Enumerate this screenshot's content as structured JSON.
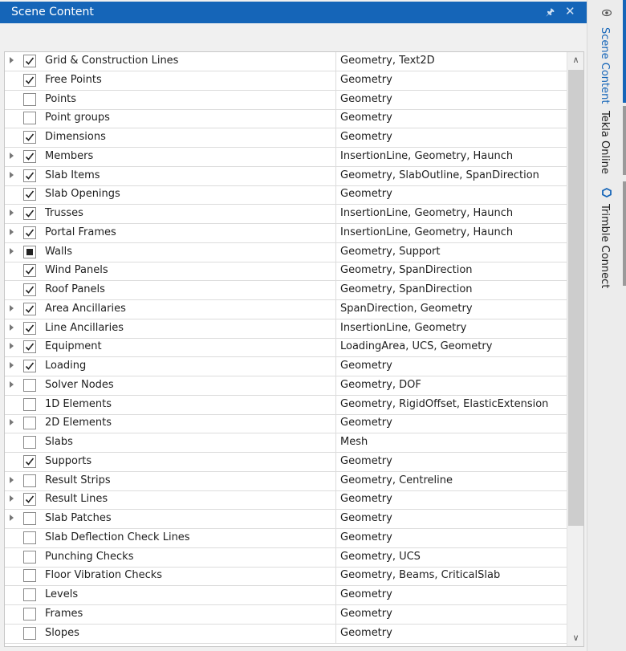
{
  "panel": {
    "title": "Scene Content",
    "pin_icon": "pin-icon",
    "close_icon": "close-icon"
  },
  "side_tabs": [
    {
      "label": "Scene Content",
      "icon": "eye-icon",
      "active": true
    },
    {
      "label": "Tekla Online",
      "active": false
    },
    {
      "label": "Trimble Connect",
      "icon": "trimble-connect-icon",
      "active": false
    }
  ],
  "rows": [
    {
      "name": "Grid & Construction Lines",
      "value": "Geometry, Text2D",
      "state": "checked",
      "expandable": true
    },
    {
      "name": "Free Points",
      "value": "Geometry",
      "state": "checked",
      "expandable": false
    },
    {
      "name": "Points",
      "value": "Geometry",
      "state": "unchecked",
      "expandable": false
    },
    {
      "name": "Point groups",
      "value": "Geometry",
      "state": "unchecked",
      "expandable": false
    },
    {
      "name": "Dimensions",
      "value": "Geometry",
      "state": "checked",
      "expandable": false
    },
    {
      "name": "Members",
      "value": "InsertionLine, Geometry, Haunch",
      "state": "checked",
      "expandable": true
    },
    {
      "name": "Slab Items",
      "value": "Geometry, SlabOutline, SpanDirection",
      "state": "checked",
      "expandable": true
    },
    {
      "name": "Slab Openings",
      "value": "Geometry",
      "state": "checked",
      "expandable": false
    },
    {
      "name": "Trusses",
      "value": "InsertionLine, Geometry, Haunch",
      "state": "checked",
      "expandable": true
    },
    {
      "name": "Portal Frames",
      "value": "InsertionLine, Geometry, Haunch",
      "state": "checked",
      "expandable": true
    },
    {
      "name": "Walls",
      "value": "Geometry, Support",
      "state": "indeterminate",
      "expandable": true
    },
    {
      "name": "Wind Panels",
      "value": "Geometry, SpanDirection",
      "state": "checked",
      "expandable": false
    },
    {
      "name": "Roof Panels",
      "value": "Geometry, SpanDirection",
      "state": "checked",
      "expandable": false
    },
    {
      "name": "Area Ancillaries",
      "value": "SpanDirection, Geometry",
      "state": "checked",
      "expandable": true
    },
    {
      "name": "Line Ancillaries",
      "value": "InsertionLine, Geometry",
      "state": "checked",
      "expandable": true
    },
    {
      "name": "Equipment",
      "value": "LoadingArea, UCS, Geometry",
      "state": "checked",
      "expandable": true
    },
    {
      "name": "Loading",
      "value": "Geometry",
      "state": "checked",
      "expandable": true
    },
    {
      "name": "Solver Nodes",
      "value": "Geometry, DOF",
      "state": "unchecked",
      "expandable": true
    },
    {
      "name": "1D Elements",
      "value": "Geometry, RigidOffset, ElasticExtension",
      "state": "unchecked",
      "expandable": false
    },
    {
      "name": "2D Elements",
      "value": "Geometry",
      "state": "unchecked",
      "expandable": true
    },
    {
      "name": "Slabs",
      "value": "Mesh",
      "state": "unchecked",
      "expandable": false
    },
    {
      "name": "Supports",
      "value": "Geometry",
      "state": "checked",
      "expandable": false
    },
    {
      "name": "Result Strips",
      "value": "Geometry, Centreline",
      "state": "unchecked",
      "expandable": true
    },
    {
      "name": "Result Lines",
      "value": "Geometry",
      "state": "checked",
      "expandable": true
    },
    {
      "name": "Slab Patches",
      "value": "Geometry",
      "state": "unchecked",
      "expandable": true
    },
    {
      "name": "Slab Deflection Check Lines",
      "value": "Geometry",
      "state": "unchecked",
      "expandable": false
    },
    {
      "name": "Punching Checks",
      "value": "Geometry, UCS",
      "state": "unchecked",
      "expandable": false
    },
    {
      "name": "Floor Vibration Checks",
      "value": "Geometry, Beams, CriticalSlab",
      "state": "unchecked",
      "expandable": false
    },
    {
      "name": "Levels",
      "value": "Geometry",
      "state": "unchecked",
      "expandable": false
    },
    {
      "name": "Frames",
      "value": "Geometry",
      "state": "unchecked",
      "expandable": false
    },
    {
      "name": "Slopes",
      "value": "Geometry",
      "state": "unchecked",
      "expandable": false
    }
  ],
  "scrollbar": {
    "up_icon": "chevron-up-icon",
    "down_icon": "chevron-down-icon"
  },
  "colors": {
    "accent": "#1565b8",
    "titlebar_text": "#ffffff"
  }
}
